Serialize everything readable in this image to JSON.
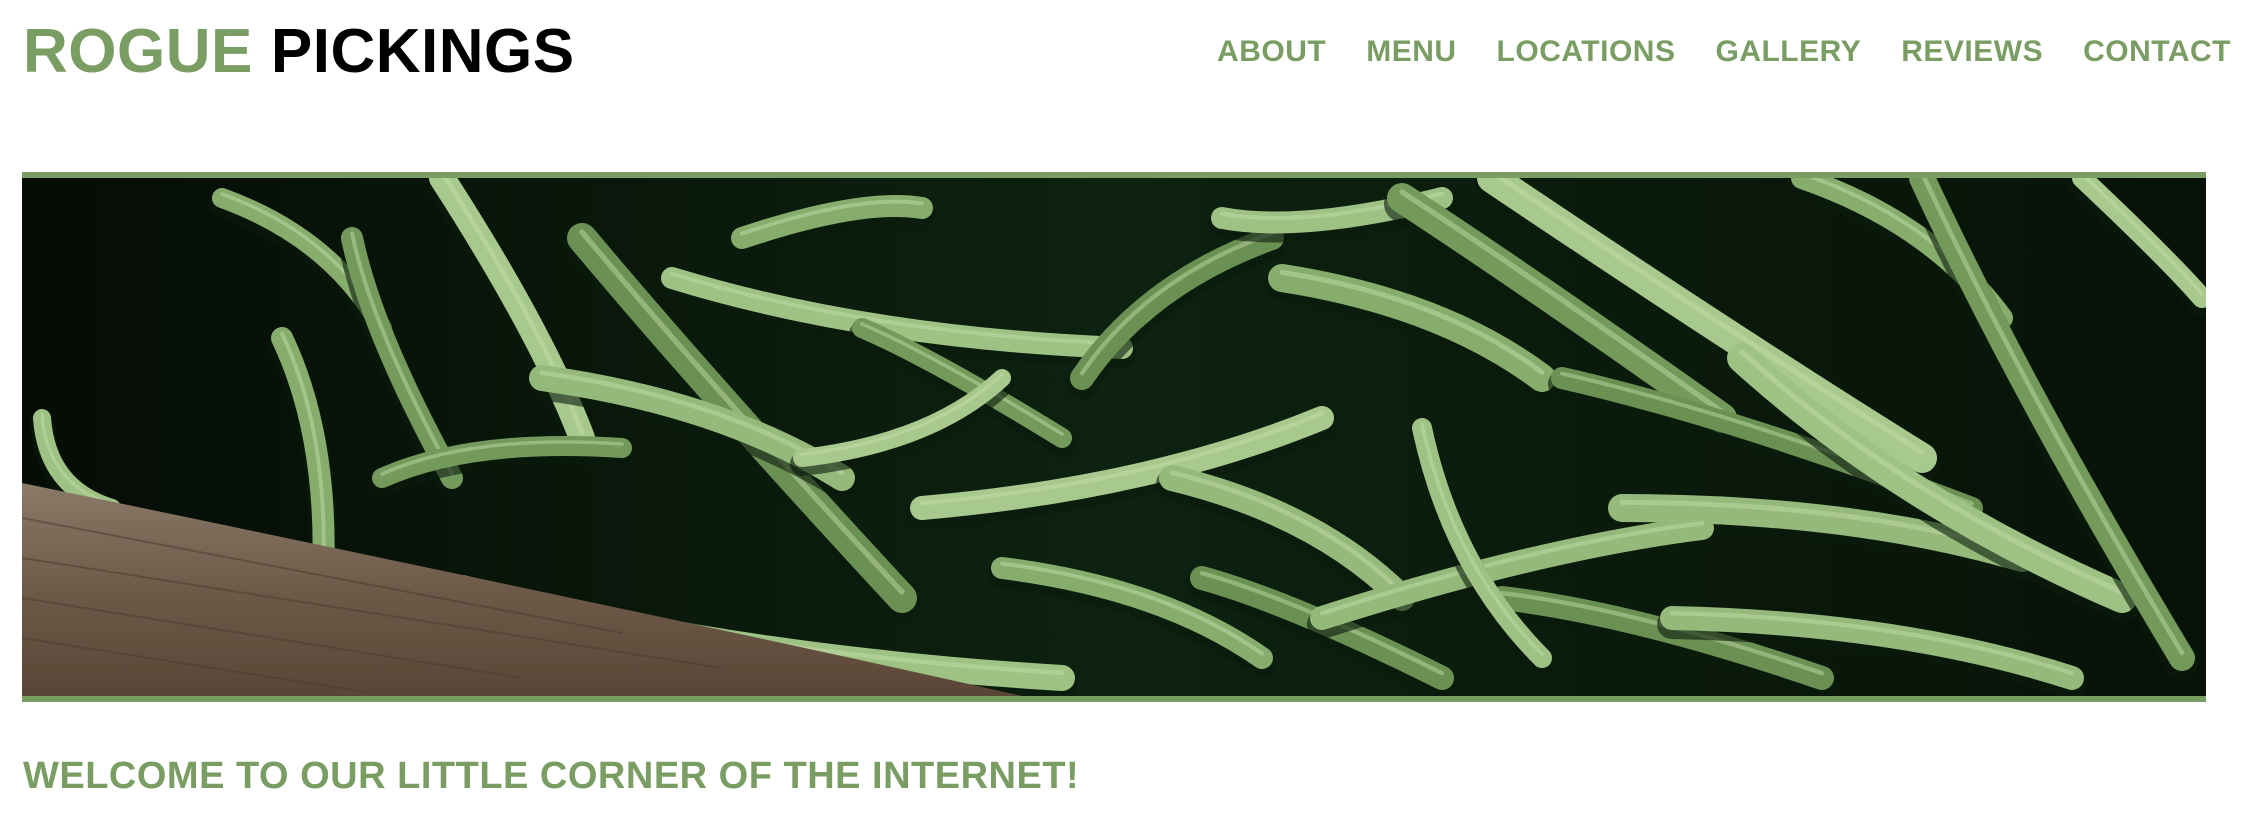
{
  "header": {
    "logo_word1": "ROGUE",
    "logo_word2": "PICKINGS"
  },
  "nav": {
    "items": [
      {
        "label": "ABOUT"
      },
      {
        "label": "MENU"
      },
      {
        "label": "LOCATIONS"
      },
      {
        "label": "GALLERY"
      },
      {
        "label": "REVIEWS"
      },
      {
        "label": "CONTACT"
      }
    ]
  },
  "hero": {
    "image_subject": "green beans in wooden crate"
  },
  "main": {
    "welcome_heading": "WELCOME TO OUR LITTLE CORNER OF THE INTERNET!"
  },
  "colors": {
    "accent": "#7a9d63",
    "logo_dark": "#000000",
    "background": "#ffffff"
  }
}
